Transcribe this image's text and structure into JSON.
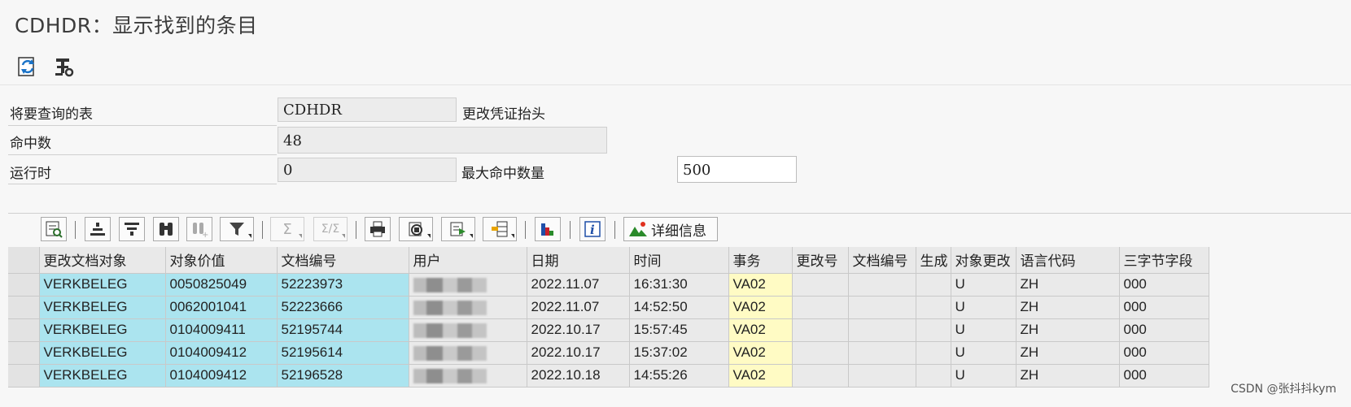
{
  "title": "CDHDR：显示找到的条目",
  "toolbar": {
    "icons": [
      "refresh-icon",
      "settings-icon"
    ]
  },
  "form": {
    "table_label": "将要查询的表",
    "table_value": "CDHDR",
    "table_desc": "更改凭证抬头",
    "hits_label": "命中数",
    "hits_value": "48",
    "runtime_label": "运行时",
    "runtime_value": "0",
    "max_hits_label": "最大命中数量",
    "max_hits_value": "500"
  },
  "grid_toolbar": {
    "details_label": "详细信息"
  },
  "grid": {
    "columns": [
      "更改文档对象",
      "对象价值",
      "文档编号",
      "用户",
      "日期",
      "时间",
      "事务",
      "更改号",
      "文档编号",
      "生成",
      "对象更改",
      "语言代码",
      "三字节字段"
    ],
    "rows": [
      [
        "VERKBELEG",
        "0050825049",
        "52223973",
        "",
        "2022.11.07",
        "16:31:30",
        "VA02",
        "",
        "",
        "",
        "U",
        "ZH",
        "000"
      ],
      [
        "VERKBELEG",
        "0062001041",
        "52223666",
        "",
        "2022.11.07",
        "14:52:50",
        "VA02",
        "",
        "",
        "",
        "U",
        "ZH",
        "000"
      ],
      [
        "VERKBELEG",
        "0104009411",
        "52195744",
        "",
        "2022.10.17",
        "15:57:45",
        "VA02",
        "",
        "",
        "",
        "U",
        "ZH",
        "000"
      ],
      [
        "VERKBELEG",
        "0104009412",
        "52195614",
        "",
        "2022.10.17",
        "15:37:02",
        "VA02",
        "",
        "",
        "",
        "U",
        "ZH",
        "000"
      ],
      [
        "VERKBELEG",
        "0104009412",
        "52196528",
        "",
        "2022.10.18",
        "14:55:26",
        "VA02",
        "",
        "",
        "",
        "U",
        "ZH",
        "000"
      ]
    ]
  },
  "watermark": "CSDN @张抖抖kym"
}
